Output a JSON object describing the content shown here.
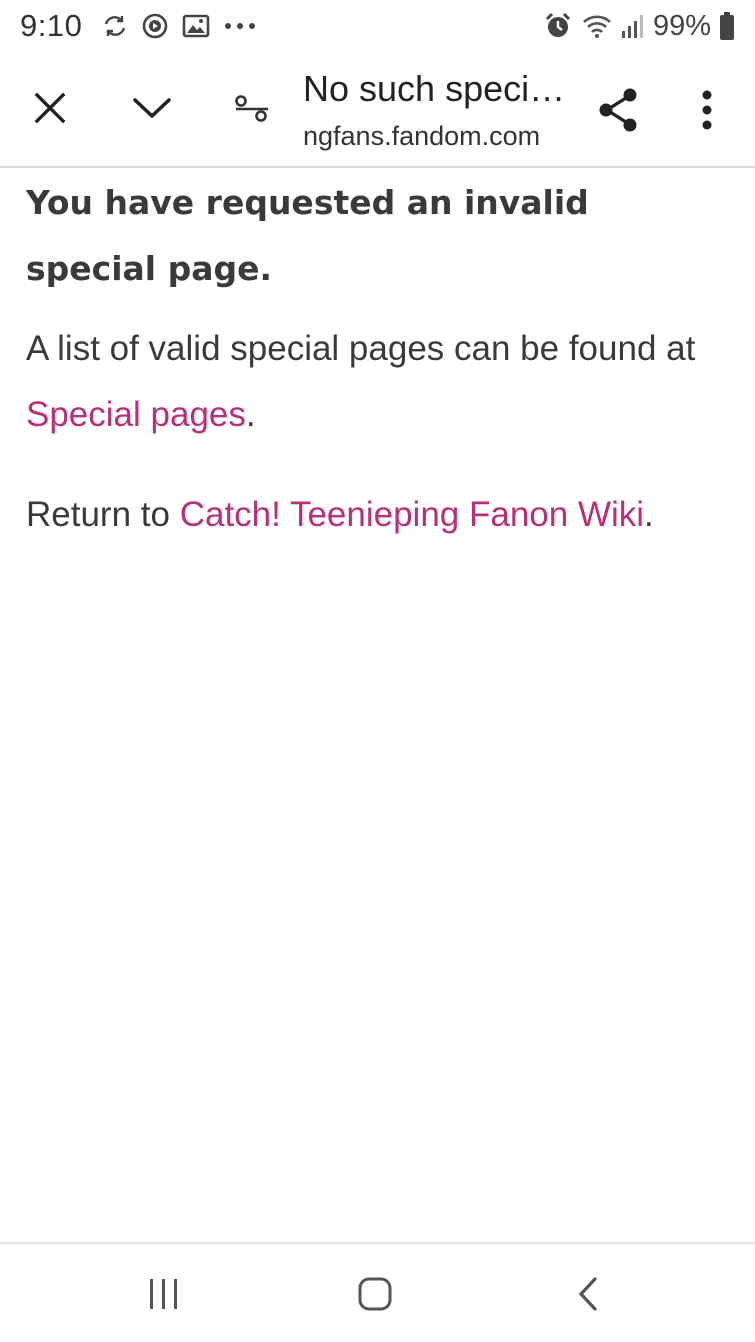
{
  "status_bar": {
    "time": "9:10",
    "left_icons": [
      "sync-icon",
      "media-play-icon",
      "gallery-icon",
      "more-dots-icon"
    ],
    "right_icons": [
      "alarm-icon",
      "wifi-icon",
      "signal-icon",
      "battery-icon"
    ],
    "battery_percent": "99%"
  },
  "toolbar": {
    "title": "No such speci…",
    "url": "ngfans.fandom.com"
  },
  "content": {
    "heading": "You have requested an invalid special page.",
    "para1_before": "A list of valid special pages can be found at ",
    "para1_link": "Special pages",
    "para1_after": ".",
    "para2_before": "Return to ",
    "para2_link": "Catch! Teenieping Fanon Wiki",
    "para2_after": "."
  },
  "colors": {
    "link": "#b8307b",
    "text": "#3a3a3a"
  }
}
